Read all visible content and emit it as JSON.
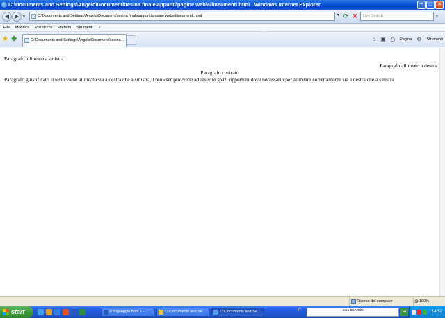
{
  "window": {
    "title": "C:\\Documents and Settings\\Angelo\\Documenti\\tesina finale\\appunti\\pagine web\\allineamenti.html - Windows Internet Explorer",
    "minimize": "–",
    "maximize": "□",
    "close": "×"
  },
  "address": {
    "url": "C:\\Documents and Settings\\Angelo\\Documenti\\tesina finale\\appunti\\pagine web\\allineamenti.html",
    "search_placeholder": "Live Search"
  },
  "menu": [
    "File",
    "Modifica",
    "Visualizza",
    "Preferiti",
    "Strumenti",
    "?"
  ],
  "tab": {
    "label": "C:\\Documents and Settings\\Angelo\\Documenti\\tesina ..."
  },
  "command_bar": {
    "page_label": "Pagina",
    "tools_label": "Strumenti"
  },
  "content": {
    "left": "Paragrafo allineato a sinistra",
    "right": "Paragrafo allineato a destra",
    "center": "Paragrafo centrato",
    "justify": "Paragrafo giustificato Il testo viene allineato sia a destra che a sinistra,il browser provvede ad inserire spazi opportuni dove necessario per allineare correttamente sia a destra che a sinistra"
  },
  "status": {
    "zone": "Risorse del computer",
    "zoom": "100%"
  },
  "taskbar": {
    "start": "start",
    "tasks": [
      "Il linguaggio html 1 - ...",
      "C:\\Documents and Se...",
      "C:\\Documents and Se..."
    ],
    "lang": "IT",
    "search_box": "nero SEARCH",
    "clock": "14.52"
  },
  "colors": {
    "title_bar": "#0a55d6",
    "taskbar": "#245edb",
    "start_button": "#3c9a3c"
  }
}
